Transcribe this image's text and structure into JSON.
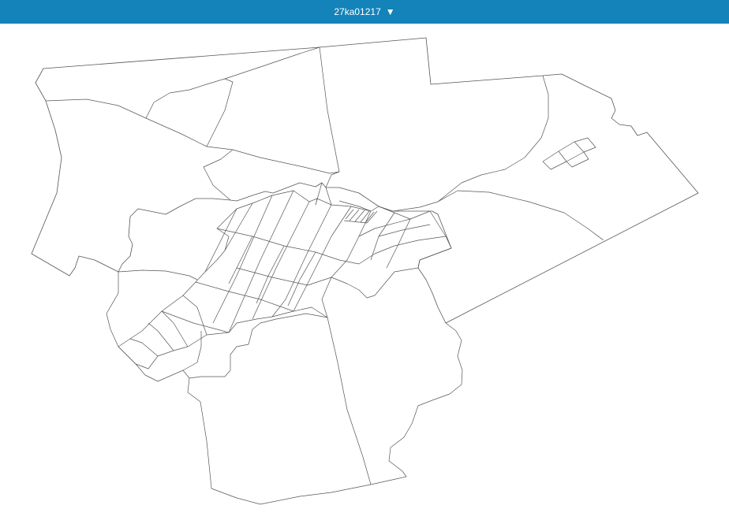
{
  "header": {
    "selector_label": "27ka01217",
    "dropdown_icon": "triangle-down-icon"
  },
  "colors": {
    "header_bg": "#1383b9",
    "header_text": "#ffffff",
    "boundary_stroke": "#555555",
    "map_bg": "#ffffff"
  }
}
